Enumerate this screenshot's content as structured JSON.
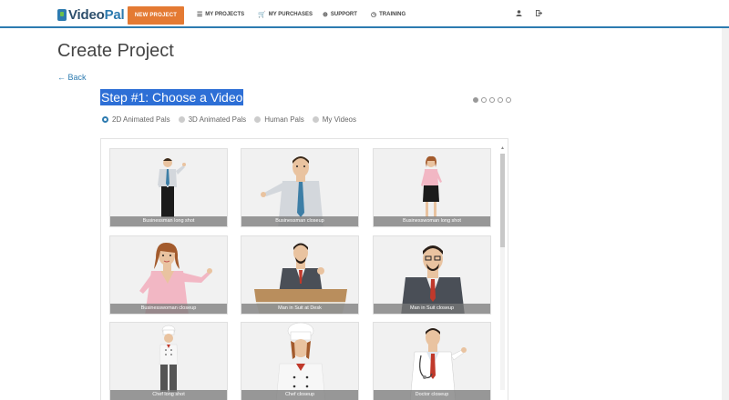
{
  "app": {
    "logo_video": "Video",
    "logo_pal": "Pal"
  },
  "nav": {
    "new_project": "NEW PROJECT",
    "my_projects": "MY PROJECTS",
    "my_purchases": "MY PURCHASES",
    "support": "SUPPORT",
    "training": "TRAINING"
  },
  "page": {
    "title": "Create Project",
    "back": "← Back",
    "step_title": "Step #1: Choose a Video",
    "step_count": 5,
    "active_step": 1
  },
  "filters": [
    {
      "label": "2D Animated Pals",
      "checked": true
    },
    {
      "label": "3D Animated Pals",
      "checked": false
    },
    {
      "label": "Human Pals",
      "checked": false
    },
    {
      "label": "My Videos",
      "checked": false
    }
  ],
  "videos": [
    {
      "label": "Businessman long shot"
    },
    {
      "label": "Businessman closeup"
    },
    {
      "label": "Businesswoman long shot"
    },
    {
      "label": "Businesswoman closeup"
    },
    {
      "label": "Man in Suit at Desk"
    },
    {
      "label": "Man in Suit closeup"
    },
    {
      "label": "Chef long shot"
    },
    {
      "label": "Chef closeup"
    },
    {
      "label": "Doctor closeup"
    }
  ],
  "colors": {
    "accent": "#2d7bb0",
    "new_project_button": "#e47a33",
    "selection_highlight": "#2d6fd6"
  }
}
